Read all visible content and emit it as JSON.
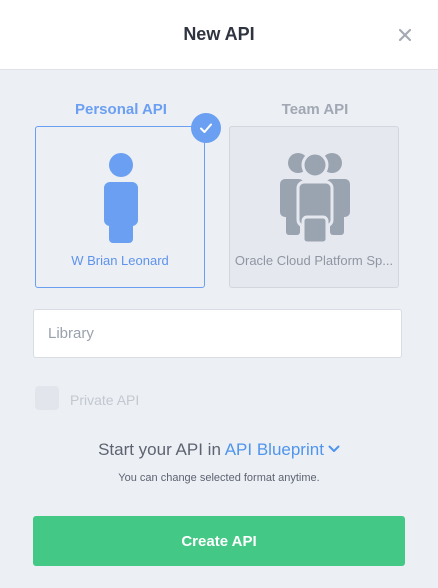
{
  "dialog": {
    "title": "New API",
    "close_icon": "close-icon"
  },
  "tabs": [
    {
      "label": "Personal API",
      "selected": true
    },
    {
      "label": "Team API",
      "selected": false
    }
  ],
  "cards": {
    "personal": {
      "name": "W Brian Leonard",
      "icon": "person-icon",
      "color": "#6b9ff2"
    },
    "team": {
      "name": "Oracle Cloud Platform Sp...",
      "icon": "team-icon",
      "color": "#9aa3b0"
    }
  },
  "form": {
    "name_placeholder": "Library",
    "name_value": "",
    "private_label": "Private API",
    "private_checked": false
  },
  "format": {
    "prefix": "Start your API in",
    "selected": "API Blueprint",
    "hint": "You can change selected format anytime."
  },
  "actions": {
    "create_label": "Create API",
    "create_color": "#43c885"
  }
}
